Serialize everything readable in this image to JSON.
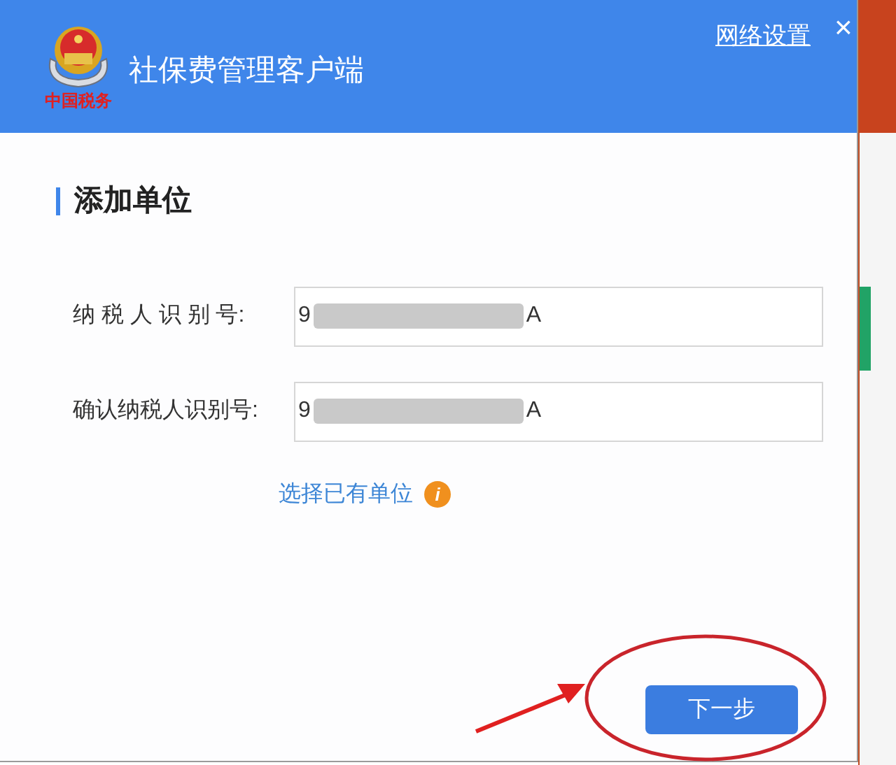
{
  "header": {
    "logo_text": "中国税务",
    "title": "社保费管理客户端",
    "network_settings_link": "网络设置",
    "close": "×"
  },
  "section_title": "添加单位",
  "fields": [
    {
      "label": "纳 税 人 识 别 号:",
      "value_start": "9",
      "value_end": "A"
    },
    {
      "label": "确认纳税人识别号:",
      "value_start": "9",
      "value_end": "A"
    }
  ],
  "choose_existing_link": "选择已有单位",
  "info_icon": "i",
  "next_button": "下一步"
}
